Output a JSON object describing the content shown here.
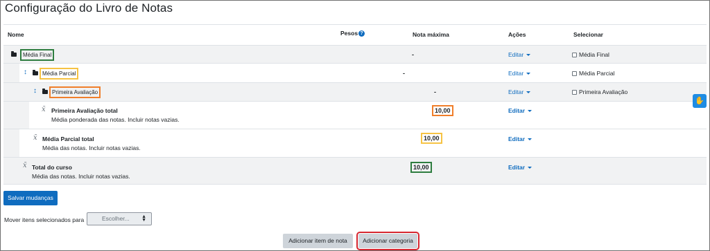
{
  "page": {
    "title": "Configuração do Livro de Notas"
  },
  "table": {
    "headers": {
      "name": "Nome",
      "weights": "Pesos",
      "max_grade": "Nota máxima",
      "actions": "Ações",
      "select": "Selecionar"
    },
    "rows": [
      {
        "type": "category",
        "label": "Média Final",
        "max": "-",
        "action": "Editar",
        "select": "Média Final",
        "highlight": "#2e7d3f"
      },
      {
        "type": "category",
        "label": "Média Parcial",
        "max": "-",
        "action": "Editar",
        "select": "Média Parcial",
        "highlight": "#f6c344"
      },
      {
        "type": "category",
        "label": "Primeira Avaliação",
        "max": "-",
        "action": "Editar",
        "select": "Primeira Avaliação",
        "highlight": "#f07e2a"
      },
      {
        "type": "total",
        "name": "Primeira Avaliação total",
        "desc": "Média ponderada das notas. Incluir notas vazias.",
        "max": "10,00",
        "action": "Editar"
      },
      {
        "type": "total",
        "name": "Média Parcial total",
        "desc": "Média das notas. Incluir notas vazias.",
        "max": "10,00",
        "action": "Editar"
      },
      {
        "type": "total",
        "name": "Total do curso",
        "desc": "Média das notas. Incluir notas vazias.",
        "max": "10,00",
        "action": "Editar"
      }
    ]
  },
  "footer": {
    "save_label": "Salvar mudanças",
    "move_label": "Mover itens selecionados para",
    "move_select_value": "Escolher...",
    "add_item_label": "Adicionar item de nota",
    "add_category_label": "Adicionar categoria"
  },
  "icons": {
    "help": "question-circle-icon",
    "folder": "folder-icon",
    "move": "move-arrows-icon",
    "calc": "x-bar-calculation-icon",
    "caret": "caret-down-icon",
    "accessibility": "accessibility-hands-icon"
  },
  "colors": {
    "primary": "#0f6cbf",
    "highlight_green": "#2e7d3f",
    "highlight_yellow": "#f6c344",
    "highlight_orange": "#f07e2a",
    "highlight_red": "#d6262f"
  }
}
